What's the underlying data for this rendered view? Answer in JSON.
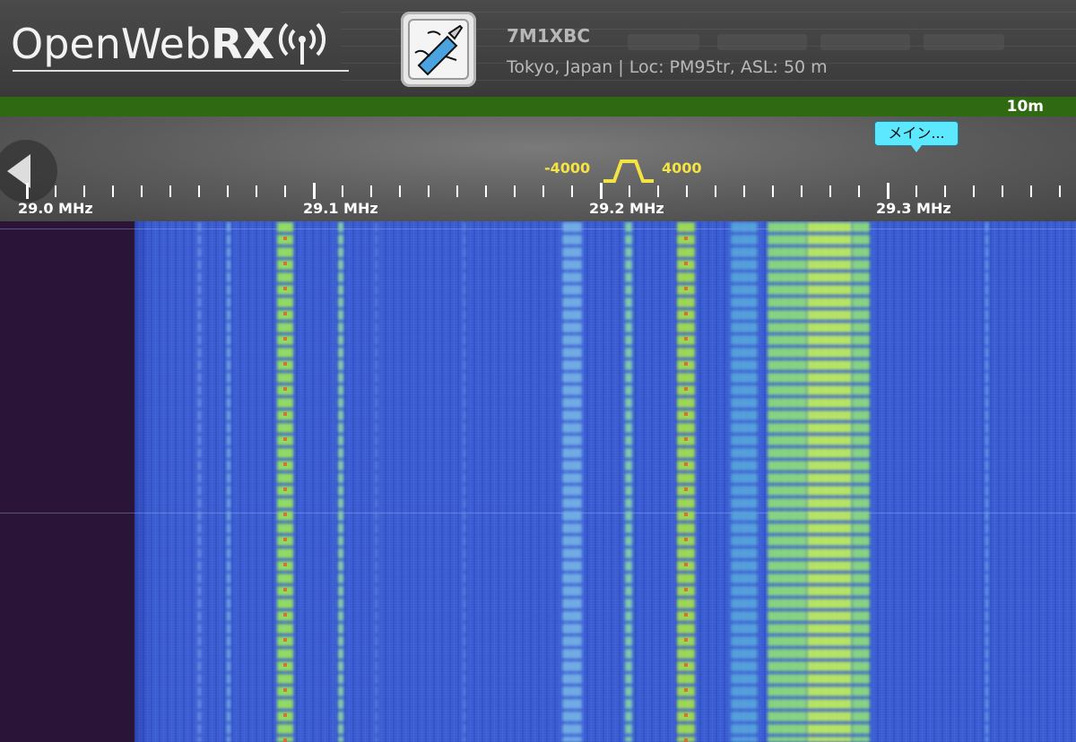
{
  "app": {
    "logo_text_open": "Open",
    "logo_text_web": "Web",
    "logo_text_rx": "RX"
  },
  "receiver": {
    "callsign": "7M1XBC",
    "location": "Tokyo, Japan | Loc: PM95tr, ASL: 50 m",
    "avatar_icon": "swiss-knife-icon"
  },
  "band": {
    "label": "10m",
    "color": "#2f6a12"
  },
  "scale": {
    "frequencies": [
      "29.0 MHz",
      "29.1 MHz",
      "29.2 MHz",
      "29.3 MHz"
    ],
    "bookmark_label": "メイン...",
    "passband_low": "-4000",
    "passband_high": "4000"
  },
  "colors": {
    "accent": "#5ce9ff",
    "passband": "#f3e343",
    "waterfall_bg": "#3c5fd6"
  }
}
